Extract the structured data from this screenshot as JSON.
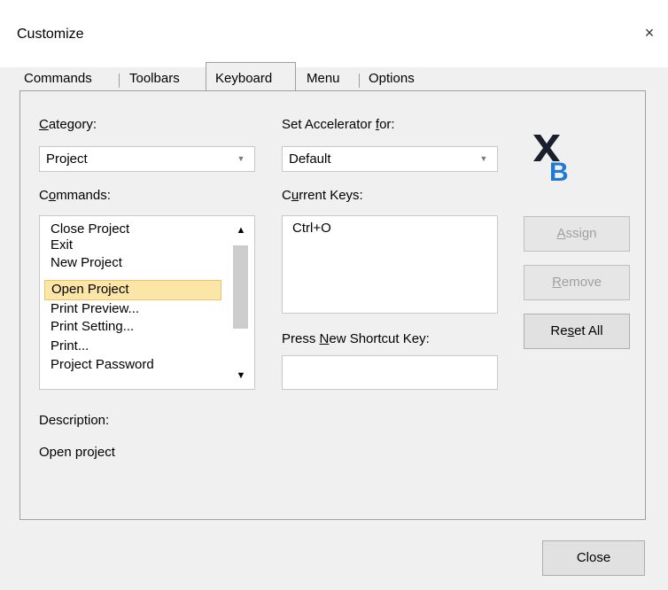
{
  "window": {
    "title": "Customize",
    "close_icon": "×"
  },
  "tabs": [
    {
      "label": "Commands",
      "active": false
    },
    {
      "label": "Toolbars",
      "active": false
    },
    {
      "label": "Keyboard",
      "active": true
    },
    {
      "label": "Menu",
      "active": false
    },
    {
      "label": "Options",
      "active": false
    }
  ],
  "category": {
    "label_pre": "",
    "label_accel": "C",
    "label_post": "ategory:",
    "value": "Project"
  },
  "accelerator": {
    "label_pre": "Set Accelerator ",
    "label_accel": "f",
    "label_post": "or:",
    "value": "Default"
  },
  "commands": {
    "label_pre": "C",
    "label_accel": "o",
    "label_post": "mmands:",
    "items": [
      "Close Project",
      "Exit",
      "New Project",
      "Open Project",
      "Print Preview...",
      "Print Setting...",
      "Print...",
      "Project Password"
    ],
    "selected_index": 3
  },
  "current_keys": {
    "label_pre": "C",
    "label_accel": "u",
    "label_post": "rrent Keys:",
    "items": [
      "Ctrl+O"
    ]
  },
  "new_shortcut": {
    "label_pre": "Press ",
    "label_accel": "N",
    "label_post": "ew Shortcut Key:",
    "value": ""
  },
  "buttons": {
    "assign": {
      "pre": "",
      "accel": "A",
      "post": "ssign",
      "enabled": false
    },
    "remove": {
      "pre": "",
      "accel": "R",
      "post": "emove",
      "enabled": false
    },
    "reset_all": {
      "pre": "Re",
      "accel": "s",
      "post": "et All",
      "enabled": true
    },
    "close": "Close"
  },
  "description": {
    "label": "Description:",
    "text": "Open project"
  },
  "logo": {
    "name": "xb-logo-icon",
    "color_dark": "#1a1f2e",
    "color_blue": "#1f7ad4"
  }
}
